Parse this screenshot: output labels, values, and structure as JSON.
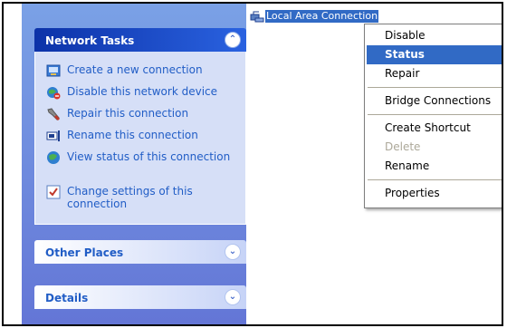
{
  "sidebar": {
    "panels": [
      {
        "title": "Network Tasks",
        "collapse_glyph": "⌃",
        "tasks": [
          {
            "label": "Create a new connection",
            "icon": "new-connection-icon"
          },
          {
            "label": "Disable this network device",
            "icon": "disable-device-icon"
          },
          {
            "label": "Repair this connection",
            "icon": "repair-icon"
          },
          {
            "label": "Rename this connection",
            "icon": "rename-icon"
          },
          {
            "label": "View status of this connection",
            "icon": "view-status-icon"
          },
          {
            "label": "Change settings of this connection",
            "icon": "change-settings-icon"
          }
        ]
      },
      {
        "title": "Other Places",
        "expand_glyph": "⌄"
      },
      {
        "title": "Details",
        "expand_glyph": "⌄"
      }
    ]
  },
  "connection": {
    "label": "Local Area Connection",
    "icon": "network-connection-icon"
  },
  "context_menu": {
    "items": [
      {
        "label": "Disable",
        "state": "normal"
      },
      {
        "label": "Status",
        "state": "selected"
      },
      {
        "label": "Repair",
        "state": "normal"
      },
      {
        "label": "Bridge Connections",
        "state": "normal"
      },
      {
        "label": "Create Shortcut",
        "state": "normal"
      },
      {
        "label": "Delete",
        "state": "disabled"
      },
      {
        "label": "Rename",
        "state": "normal"
      },
      {
        "label": "Properties",
        "state": "normal"
      }
    ]
  },
  "colors": {
    "selection": "#316ac5",
    "task_link": "#215dc6",
    "panel_header_active": "#0c32a8",
    "sidebar_bg": "#7aa1e6"
  }
}
